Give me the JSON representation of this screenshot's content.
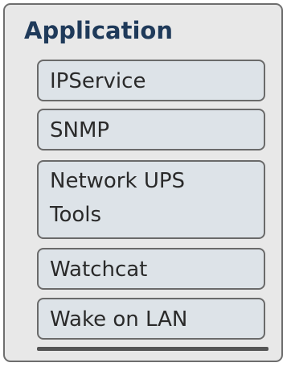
{
  "panel": {
    "title": "Application",
    "items": [
      {
        "label": "IPService"
      },
      {
        "label": "SNMP"
      },
      {
        "label_lines": [
          "Network UPS",
          "Tools"
        ]
      },
      {
        "label": "Watchcat"
      },
      {
        "label": "Wake on LAN"
      }
    ]
  }
}
